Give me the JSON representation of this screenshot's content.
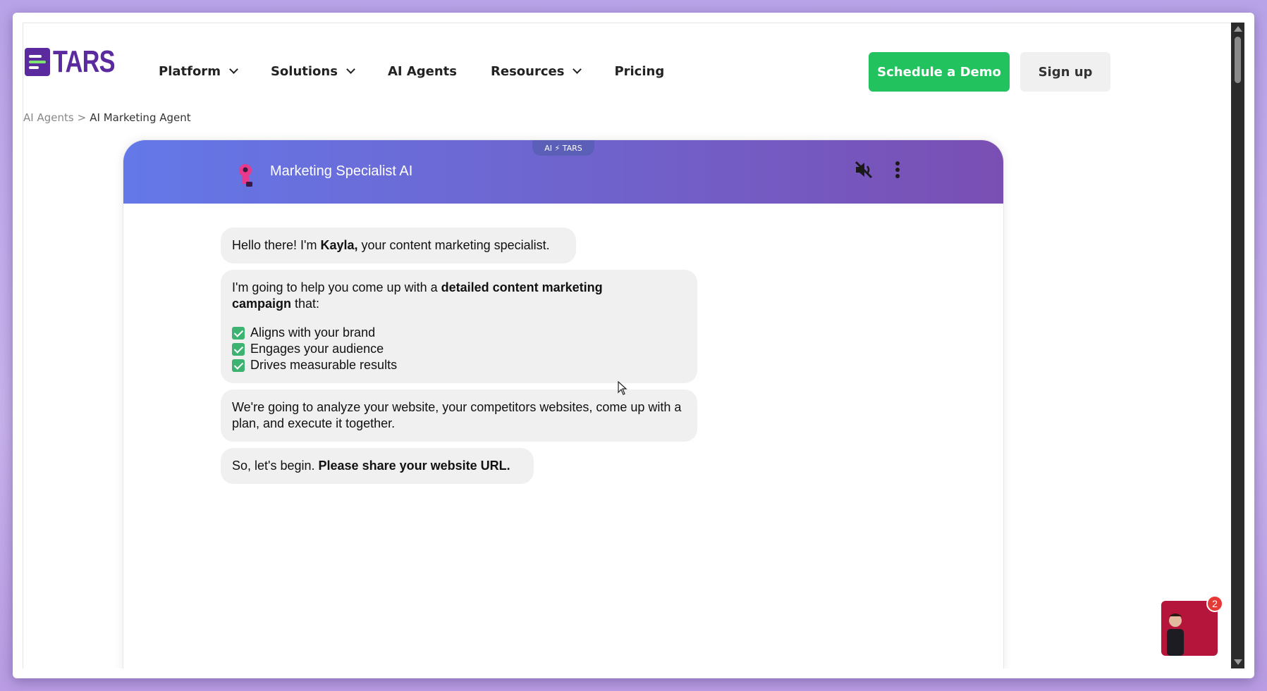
{
  "header": {
    "logo_text": "TARS",
    "nav": [
      {
        "label": "Platform",
        "has_dropdown": true
      },
      {
        "label": "Solutions",
        "has_dropdown": true
      },
      {
        "label": "AI Agents",
        "has_dropdown": false
      },
      {
        "label": "Resources",
        "has_dropdown": true
      },
      {
        "label": "Pricing",
        "has_dropdown": false
      }
    ],
    "demo_label": "Schedule a Demo",
    "signup_label": "Sign up",
    "demo_color": "#22c35e",
    "brand_color": "#5b2a9e"
  },
  "breadcrumb": {
    "parent": "AI Agents",
    "separator": ">",
    "current": "AI Marketing Agent"
  },
  "chat": {
    "badge": "AI ⚡ TARS",
    "title": "Marketing Specialist AI",
    "icons": [
      "robot-avatar-icon",
      "mute-icon",
      "more-vertical-icon"
    ],
    "messages": {
      "m1": {
        "pre": "Hello there! I'm ",
        "bold": "Kayla,",
        "post": " your content marketing specialist."
      },
      "m2": {
        "pre": "I'm going to help you come up with a ",
        "bold": "detailed content marketing campaign",
        "post": " that:",
        "checklist": [
          "Aligns with your brand",
          "Engages your audience",
          "Drives measurable results"
        ]
      },
      "m3": {
        "text": "We're going to analyze your website, your competitors websites, come up with a plan, and execute it together."
      },
      "m4": {
        "pre": "So, let's begin. ",
        "bold": "Please share your website URL."
      }
    }
  },
  "video_widget": {
    "notification_count": "2"
  }
}
